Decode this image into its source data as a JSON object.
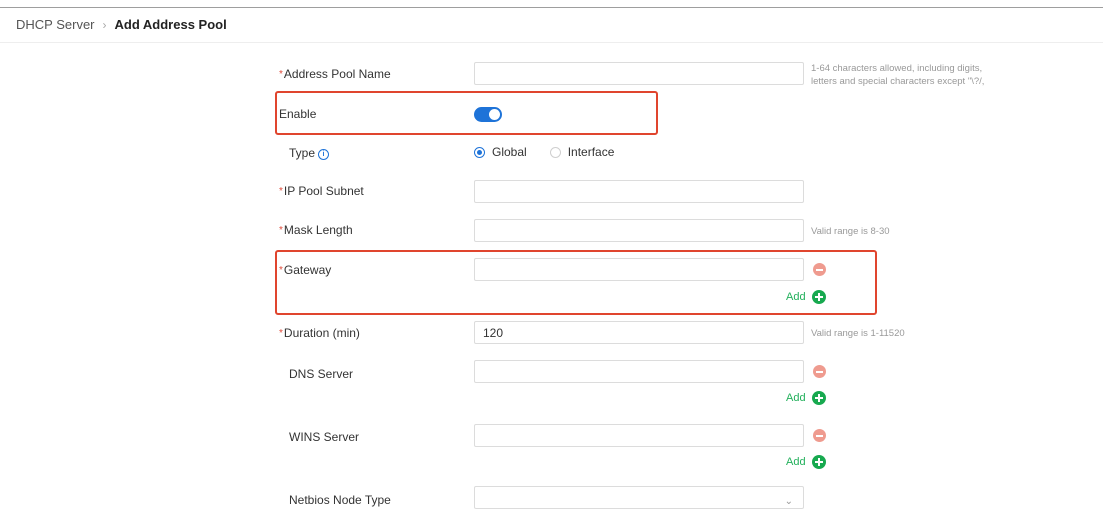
{
  "breadcrumb": {
    "parent": "DHCP Server",
    "separator": "›",
    "current": "Add Address Pool"
  },
  "form": {
    "required_mark": "*",
    "pool_name": {
      "label": "Address Pool Name",
      "value": "",
      "hint_line1": "1-64 characters allowed, including digits,",
      "hint_line2": "letters and special characters except \"\\?/,"
    },
    "enable": {
      "label": "Enable",
      "value": true
    },
    "type": {
      "label": "Type",
      "info_glyph": "i",
      "options": [
        "Global",
        "Interface"
      ],
      "selected": "Global"
    },
    "ip_pool_subnet": {
      "label": "IP Pool Subnet",
      "value": ""
    },
    "mask_length": {
      "label": "Mask Length",
      "value": "",
      "hint": "Valid range is 8-30"
    },
    "gateway": {
      "label": "Gateway",
      "value": "",
      "add_label": "Add"
    },
    "duration": {
      "label": "Duration (min)",
      "value": "120",
      "hint": "Valid range is 1-11520"
    },
    "dns_server": {
      "label": "DNS Server",
      "value": "",
      "add_label": "Add"
    },
    "wins_server": {
      "label": "WINS Server",
      "value": "",
      "add_label": "Add"
    },
    "netbios_node_type": {
      "label": "Netbios Node Type",
      "value": "",
      "chevron": "⌄"
    }
  },
  "colors": {
    "accent": "#1e73d8",
    "required": "#e04b3a",
    "add_green": "#17a94f",
    "remove_red": "#ef9b8f",
    "highlight": "#e0452e"
  },
  "icons": [
    "info-icon",
    "minus-circle-icon",
    "plus-circle-icon",
    "chevron-down-icon"
  ]
}
